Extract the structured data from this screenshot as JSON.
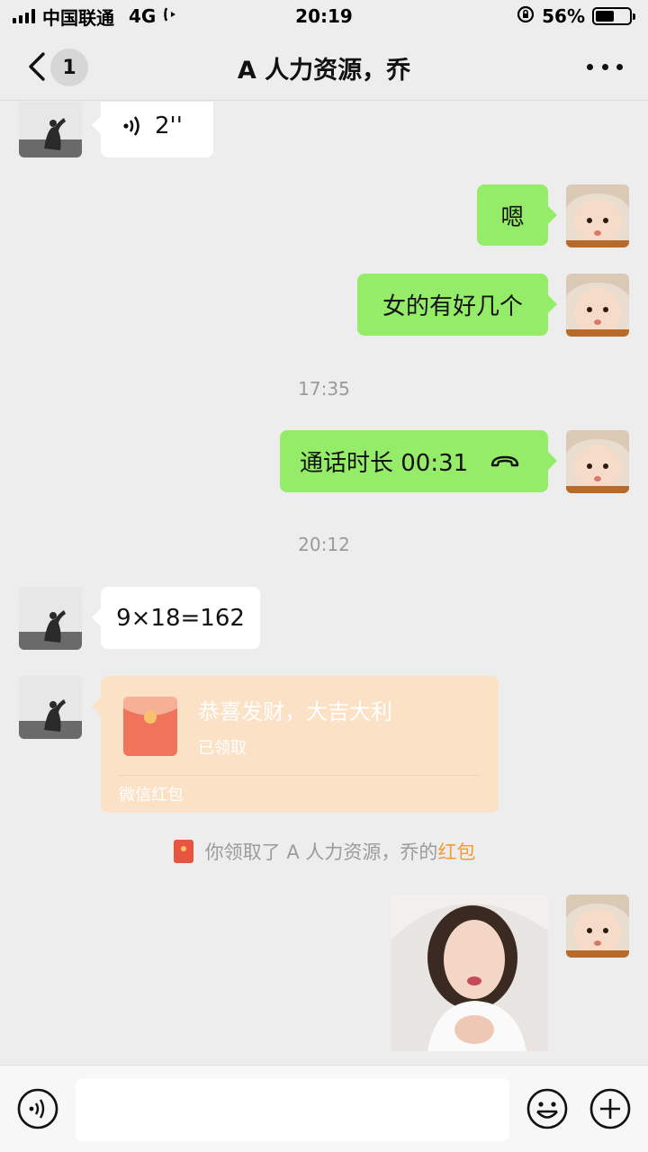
{
  "status_bar": {
    "carrier": "中国联通",
    "network": "4G",
    "time": "20:19",
    "battery": "56%",
    "battery_level": 0.56
  },
  "nav": {
    "unread_count": "1",
    "title": "A 人力资源，乔"
  },
  "messages": {
    "voice_duration": "2''",
    "msg_1": "嗯",
    "msg_2": "女的有好几个",
    "time_1": "17:35",
    "call_text": "通话时长 00:31",
    "time_2": "20:12",
    "msg_3": "9×18=162",
    "red_packet": {
      "title": "恭喜发财，大吉大利",
      "status": "已领取",
      "footer": "微信红包"
    },
    "system_note": {
      "text": "你领取了 A 人力资源，乔的",
      "link": "红包"
    }
  },
  "colors": {
    "outgoing_bubble": "#95ec69",
    "incoming_bubble": "#ffffff",
    "background": "#ededed",
    "red_packet": "#fbe1c5",
    "link": "#f29b38"
  },
  "icons": [
    "back-icon",
    "more-icon",
    "voice-message-icon",
    "phone-hangup-icon",
    "red-packet-icon",
    "voice-input-icon",
    "emoji-icon",
    "plus-icon"
  ]
}
